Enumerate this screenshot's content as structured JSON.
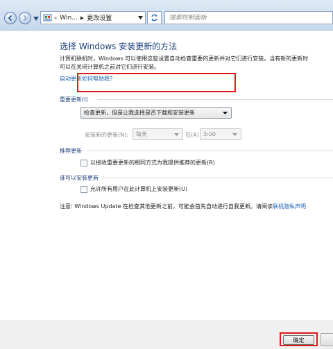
{
  "nav": {
    "breadcrumbs": [
      "Win...",
      "更改设置"
    ],
    "search_placeholder": "搜索控制面板"
  },
  "page": {
    "heading": "选择 Windows 安装更新的方法",
    "description_line1": "计算机联机时，Windows 可以使用这些设置自动检查重要的更新并对它们进行安装。当有新的更新时",
    "description_line2": "可以在关闭计算机之前对它们进行安装。",
    "help_link": "自动更新如何帮助我?"
  },
  "important_updates": {
    "section_label": "重要更新(I)",
    "selected_option": "检查更新，但是让我选择是否下载和安装更新",
    "install_label": "安装新的更新(N):",
    "day_value": "每天",
    "at_label": "在(A)",
    "time_value": "3:00"
  },
  "recommended_updates": {
    "section_label": "推荐更新",
    "checkbox_label": "以接收重要更新的相同方式为我提供推荐的更新(R)",
    "checked": false
  },
  "who_can_install": {
    "section_label": "谁可以安装更新",
    "checkbox_label": "允许所有用户在此计算机上安装更新(U)",
    "checked": false
  },
  "note": {
    "text": "注意: Windows Update 在检查其他更新之前，可能会首先自动进行自我更新。请阅读",
    "link": "联机隐私声明"
  },
  "footer": {
    "ok_label": "确定"
  },
  "colors": {
    "heading": "#1c3f7a",
    "link": "#1a5fb4",
    "highlight": "#e01818"
  },
  "icons": [
    "back-arrow-icon",
    "forward-arrow-icon",
    "control-panel-icon",
    "refresh-icon",
    "chevron-down-icon"
  ]
}
